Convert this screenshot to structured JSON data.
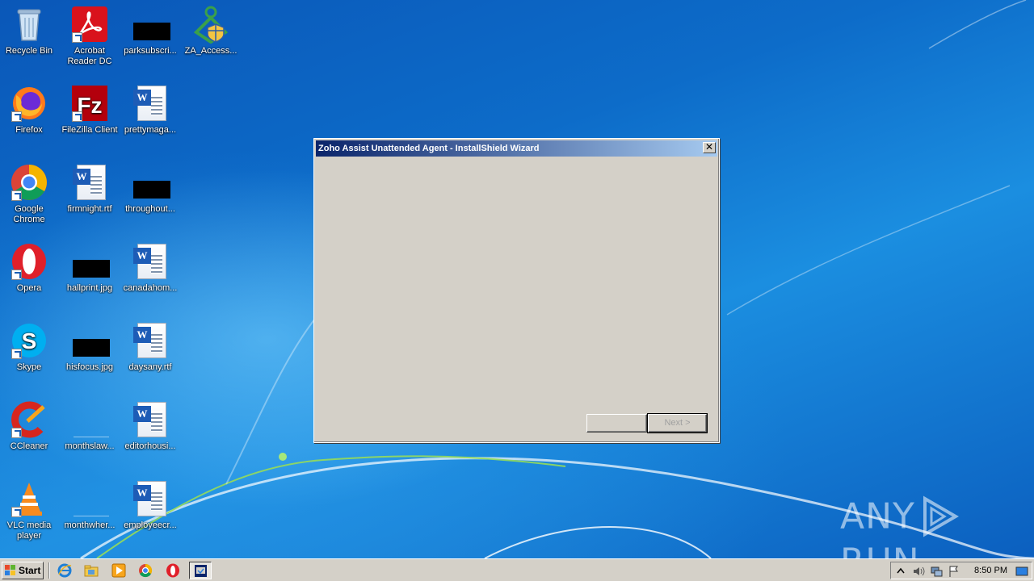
{
  "desktop": {
    "icons": [
      {
        "label": "Recycle Bin",
        "type": "recycle"
      },
      {
        "label": "Acrobat Reader DC",
        "type": "acrobat"
      },
      {
        "label": "parksubscri...",
        "type": "black"
      },
      {
        "label": "ZA_Access...",
        "type": "za"
      },
      {
        "label": "Firefox",
        "type": "firefox"
      },
      {
        "label": "FileZilla Client",
        "type": "filezilla"
      },
      {
        "label": "prettymaga...",
        "type": "word"
      },
      {
        "label": "Google Chrome",
        "type": "chrome"
      },
      {
        "label": "firmnight.rtf",
        "type": "word"
      },
      {
        "label": "throughout...",
        "type": "black"
      },
      {
        "label": "Opera",
        "type": "opera"
      },
      {
        "label": "hallprint.jpg",
        "type": "black"
      },
      {
        "label": "canadahom...",
        "type": "word"
      },
      {
        "label": "Skype",
        "type": "skype"
      },
      {
        "label": "hisfocus.jpg",
        "type": "black"
      },
      {
        "label": "daysany.rtf",
        "type": "word"
      },
      {
        "label": "CCleaner",
        "type": "ccleaner"
      },
      {
        "label": "monthslaw...",
        "type": "blank"
      },
      {
        "label": "editorhousi...",
        "type": "word"
      },
      {
        "label": "VLC media player",
        "type": "vlc"
      },
      {
        "label": "monthwher...",
        "type": "blank"
      },
      {
        "label": "employeecr...",
        "type": "word"
      }
    ]
  },
  "dialog": {
    "title": "Zoho Assist Unattended Agent - InstallShield Wizard",
    "close_label": "✕",
    "back_label": "",
    "next_label": "Next >"
  },
  "taskbar": {
    "start_label": "Start",
    "clock": "8:50 PM"
  },
  "watermark": {
    "left": "ANY",
    "right": "RUN"
  },
  "colors": {
    "titlebar_start": "#0a246a",
    "titlebar_end": "#a6caf0",
    "dialog_face": "#d4d0c8"
  }
}
